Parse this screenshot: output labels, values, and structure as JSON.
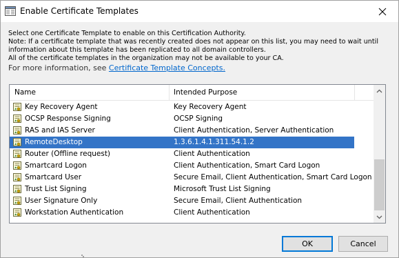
{
  "window": {
    "title": "Enable Certificate Templates"
  },
  "description": {
    "line1": "Select one Certificate Template to enable on this Certification Authority.",
    "line2": "Note: If a certificate template that was recently created does not appear on this list, you may need to wait until",
    "line3": "information about this template has been replicated to all domain controllers.",
    "line4": "All of the certificate templates in the organization may not be available to your CA.",
    "more_prefix": "For more information, see ",
    "more_link": "Certificate Template Concepts."
  },
  "list": {
    "columns": {
      "name": "Name",
      "purpose": "Intended Purpose"
    },
    "rows": [
      {
        "name": "Key Recovery Agent",
        "purpose": "Key Recovery Agent"
      },
      {
        "name": "OCSP Response Signing",
        "purpose": "OCSP Signing"
      },
      {
        "name": "RAS and IAS Server",
        "purpose": "Client Authentication, Server Authentication"
      },
      {
        "name": "RemoteDesktop",
        "purpose": "1.3.6.1.4.1.311.54.1.2",
        "selected": true
      },
      {
        "name": "Router (Offline request)",
        "purpose": "Client Authentication"
      },
      {
        "name": "Smartcard Logon",
        "purpose": "Client Authentication, Smart Card Logon"
      },
      {
        "name": "Smartcard User",
        "purpose": "Secure Email, Client Authentication, Smart Card Logon"
      },
      {
        "name": "Trust List Signing",
        "purpose": "Microsoft Trust List Signing"
      },
      {
        "name": "User Signature Only",
        "purpose": "Secure Email, Client Authentication"
      },
      {
        "name": "Workstation Authentication",
        "purpose": "Client Authentication"
      }
    ]
  },
  "buttons": {
    "ok": "OK",
    "cancel": "Cancel"
  },
  "colors": {
    "selection": "#3374c7",
    "link": "#0066cc",
    "default_button_border": "#0078d7"
  },
  "icons": {
    "window": "certificate-template-window-icon",
    "row": "certificate-template-icon",
    "close": "close-icon"
  }
}
